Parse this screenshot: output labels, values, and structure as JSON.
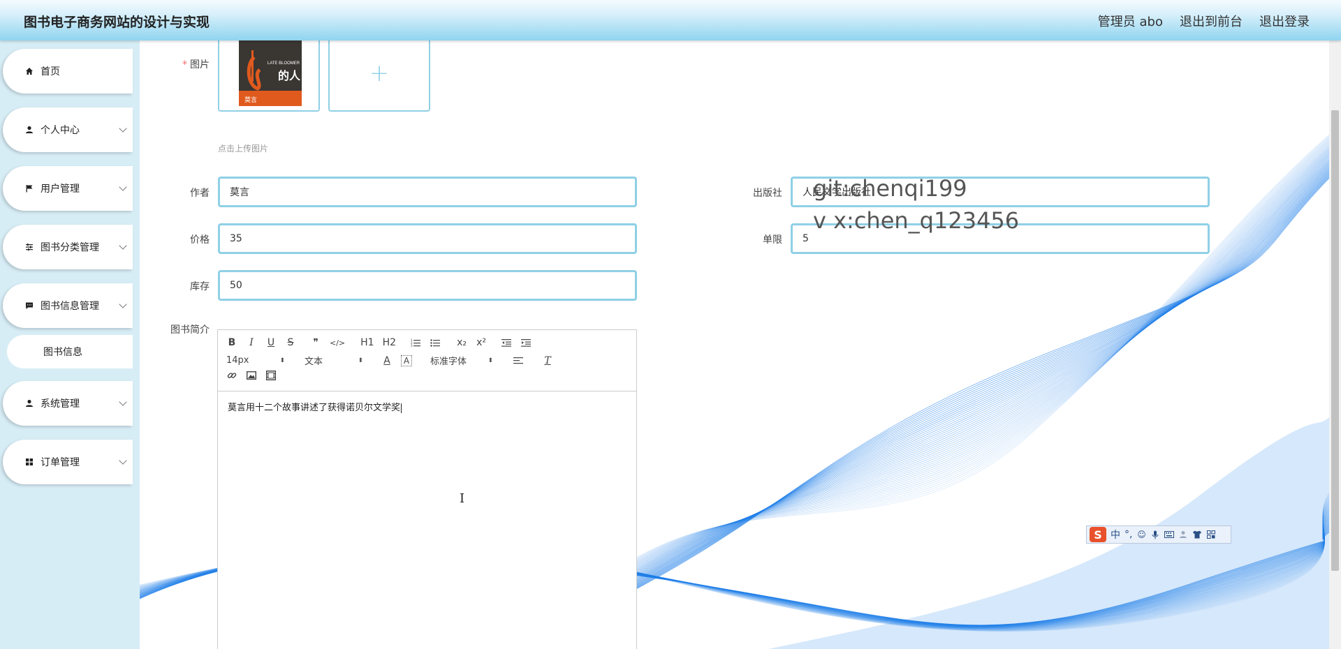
{
  "header": {
    "title": "图书电子商务网站的设计与实现",
    "links": [
      "管理员 abo",
      "退出到前台",
      "退出登录"
    ]
  },
  "sidebar": {
    "items": [
      {
        "label": "首页",
        "icon": "home-icon"
      },
      {
        "label": "个人中心",
        "icon": "user-icon"
      },
      {
        "label": "用户管理",
        "icon": "flag-icon"
      },
      {
        "label": "图书分类管理",
        "icon": "sliders-icon"
      },
      {
        "label": "图书信息管理",
        "icon": "message-icon"
      },
      {
        "label": "系统管理",
        "icon": "user-icon"
      },
      {
        "label": "订单管理",
        "icon": "grid-icon"
      }
    ],
    "submenu": {
      "label": "图书信息"
    }
  },
  "form": {
    "image_label": "图片",
    "upload_hint": "点击上传图片",
    "book_cover_texts": {
      "top": "LATE BLOOMER",
      "big": "的人",
      "bottom": "莫言"
    },
    "author_label": "作者",
    "author_value": "莫言",
    "publisher_label": "出版社",
    "publisher_value": "人民文学出版社",
    "price_label": "价格",
    "price_value": "35",
    "limit_label": "单限",
    "limit_value": "5",
    "stock_label": "库存",
    "stock_value": "50",
    "intro_label": "图书简介",
    "intro_text": "莫言用十二个故事讲述了获得诺贝尔文学奖"
  },
  "editor_toolbar": {
    "row1": [
      "B",
      "I",
      "U",
      "S",
      "❞",
      "</>",
      "H1",
      "H2",
      "ol",
      "ul",
      "x₂",
      "x²",
      "outdent",
      "indent"
    ],
    "font_size": "14px",
    "text_type": "文本",
    "font_family": "标准字体",
    "row3": [
      "link",
      "image",
      "video"
    ]
  },
  "watermark": {
    "line1": "git:chenqi199",
    "line2": "v x:chen_q123456"
  },
  "ime": {
    "lang": "中",
    "punct": "°,"
  },
  "colors": {
    "accent": "#8fd0e6",
    "header_bottom": "#8fd4ef",
    "sidebar_bg": "#d7edf6",
    "wave": "#1e7ee8"
  }
}
